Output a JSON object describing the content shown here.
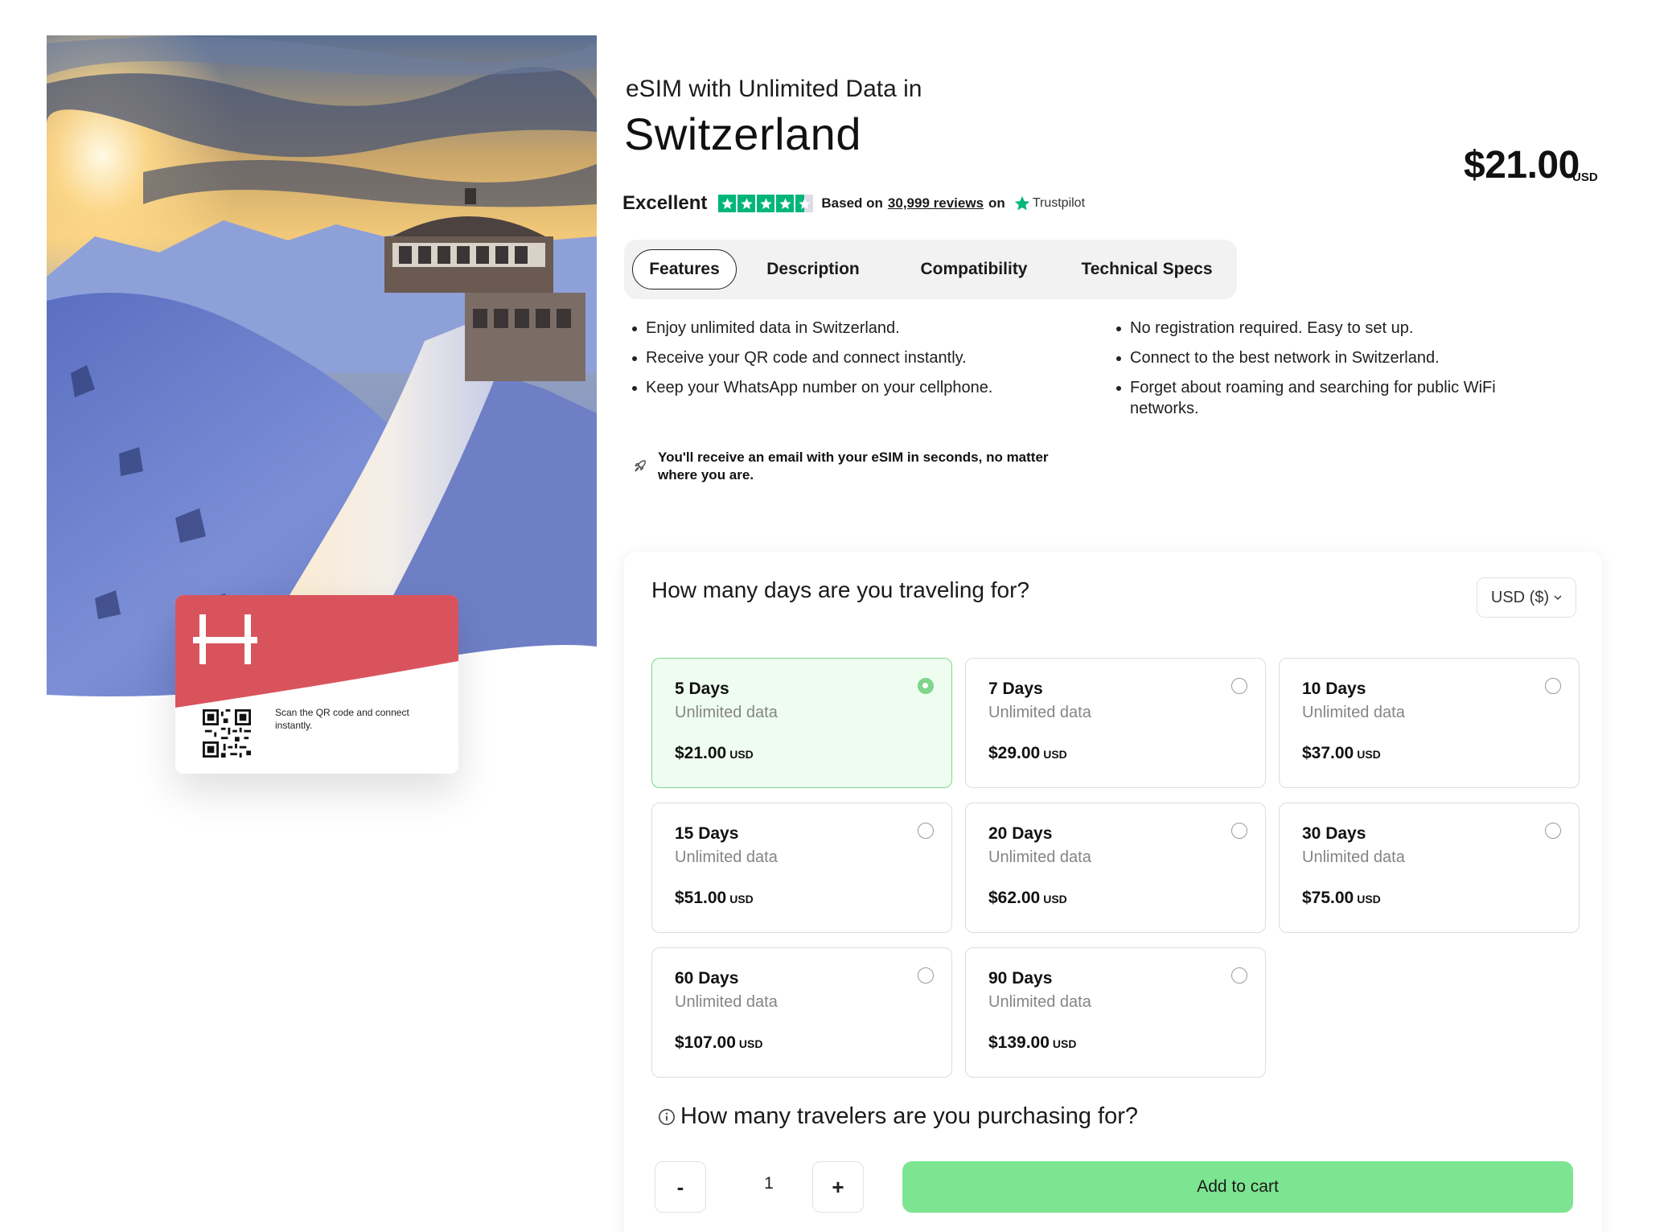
{
  "product": {
    "subtitle": "eSIM with Unlimited Data in",
    "country": "Switzerland",
    "price": "$21.00",
    "currency_label": "USD"
  },
  "card": {
    "scan_text": "Scan the QR code and connect instantly."
  },
  "rating": {
    "label": "Excellent",
    "stars": 4.5,
    "based_on": "Based on",
    "reviews": "30,999 reviews",
    "on": "on",
    "provider": "Trustpilot"
  },
  "tabs": [
    {
      "label": "Features",
      "active": true
    },
    {
      "label": "Description",
      "active": false
    },
    {
      "label": "Compatibility",
      "active": false
    },
    {
      "label": "Technical Specs",
      "active": false
    }
  ],
  "features": {
    "left": [
      "Enjoy unlimited data in Switzerland.",
      "Receive your QR code and connect instantly.",
      "Keep your WhatsApp number on your cellphone."
    ],
    "right": [
      "No registration required. Easy to set up.",
      "Connect to the best network in Switzerland.",
      "Forget about roaming and searching for public WiFi networks."
    ]
  },
  "note": {
    "icon": "rocket-icon",
    "text": "You'll receive an email with your eSIM in seconds, no matter where you are."
  },
  "plans_section": {
    "question": "How many days are you traveling for?",
    "currency_select": "USD ($)",
    "plans": [
      {
        "days": "5 Days",
        "data": "Unlimited data",
        "price": "$21.00",
        "currency": "USD",
        "selected": true
      },
      {
        "days": "7 Days",
        "data": "Unlimited data",
        "price": "$29.00",
        "currency": "USD",
        "selected": false
      },
      {
        "days": "10 Days",
        "data": "Unlimited data",
        "price": "$37.00",
        "currency": "USD",
        "selected": false
      },
      {
        "days": "15 Days",
        "data": "Unlimited data",
        "price": "$51.00",
        "currency": "USD",
        "selected": false
      },
      {
        "days": "20 Days",
        "data": "Unlimited data",
        "price": "$62.00",
        "currency": "USD",
        "selected": false
      },
      {
        "days": "30 Days",
        "data": "Unlimited data",
        "price": "$75.00",
        "currency": "USD",
        "selected": false
      },
      {
        "days": "60 Days",
        "data": "Unlimited data",
        "price": "$107.00",
        "currency": "USD",
        "selected": false
      },
      {
        "days": "90 Days",
        "data": "Unlimited data",
        "price": "$139.00",
        "currency": "USD",
        "selected": false
      }
    ]
  },
  "travelers": {
    "question": "How many travelers are you purchasing for?",
    "minus": "-",
    "quantity": "1",
    "plus": "+",
    "add_to_cart": "Add to cart"
  },
  "colors": {
    "accent_green": "#7de592",
    "selected_bg": "#effdf0",
    "trustpilot_green": "#00b67a",
    "card_red": "#d9535d"
  }
}
